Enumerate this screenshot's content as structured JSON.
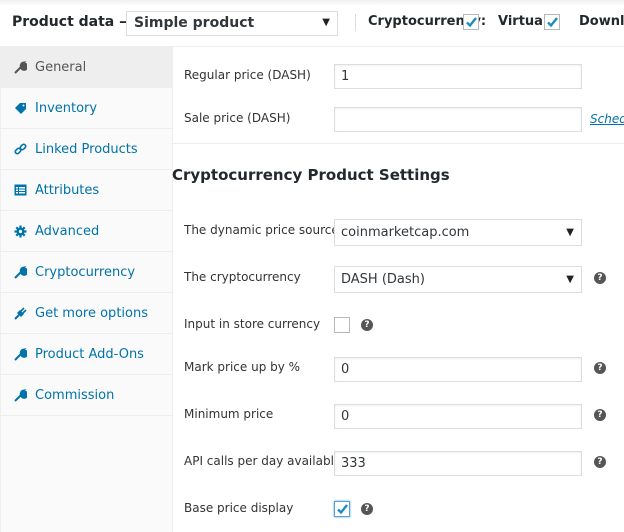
{
  "header": {
    "title": "Product data —",
    "product_type": "Simple product",
    "options": [
      {
        "label": "Cryptocurrency:",
        "checked": true
      },
      {
        "label": "Virtual:",
        "checked": true
      },
      {
        "label": "Downlo",
        "checked": false
      }
    ]
  },
  "sidebar": {
    "tabs": [
      {
        "label": "General",
        "icon": "wrench-icon",
        "active": true
      },
      {
        "label": "Inventory",
        "icon": "tag-icon",
        "active": false
      },
      {
        "label": "Linked Products",
        "icon": "link-icon",
        "active": false
      },
      {
        "label": "Attributes",
        "icon": "list-icon",
        "active": false
      },
      {
        "label": "Advanced",
        "icon": "gear-icon",
        "active": false
      },
      {
        "label": "Cryptocurrency",
        "icon": "wrench-icon",
        "active": false
      },
      {
        "label": "Get more options",
        "icon": "plug-icon",
        "active": false
      },
      {
        "label": "Product Add-Ons",
        "icon": "wrench-icon",
        "active": false
      },
      {
        "label": "Commission",
        "icon": "wrench-icon",
        "active": false
      }
    ]
  },
  "general": {
    "regular_price_label": "Regular price (DASH)",
    "regular_price_value": "1",
    "sale_price_label": "Sale price (DASH)",
    "sale_price_value": "",
    "schedule_link": "Sched"
  },
  "crypto": {
    "section_title": "Cryptocurrency Product Settings",
    "price_source_label": "The dynamic price source",
    "price_source_value": "coinmarketcap.com",
    "cryptocurrency_label": "The cryptocurrency",
    "cryptocurrency_value": "DASH (Dash)",
    "store_currency_label": "Input in store currency",
    "store_currency_checked": false,
    "markup_label": "Mark price up by %",
    "markup_value": "0",
    "min_price_label": "Minimum price",
    "min_price_value": "0",
    "api_calls_label": "API calls per day available",
    "api_calls_value": "333",
    "base_price_label": "Base price display",
    "base_price_checked": true
  },
  "help_glyph": "?",
  "select_arrow": "▼",
  "colors": {
    "link": "#0073aa",
    "check": "#1e8cbe"
  }
}
